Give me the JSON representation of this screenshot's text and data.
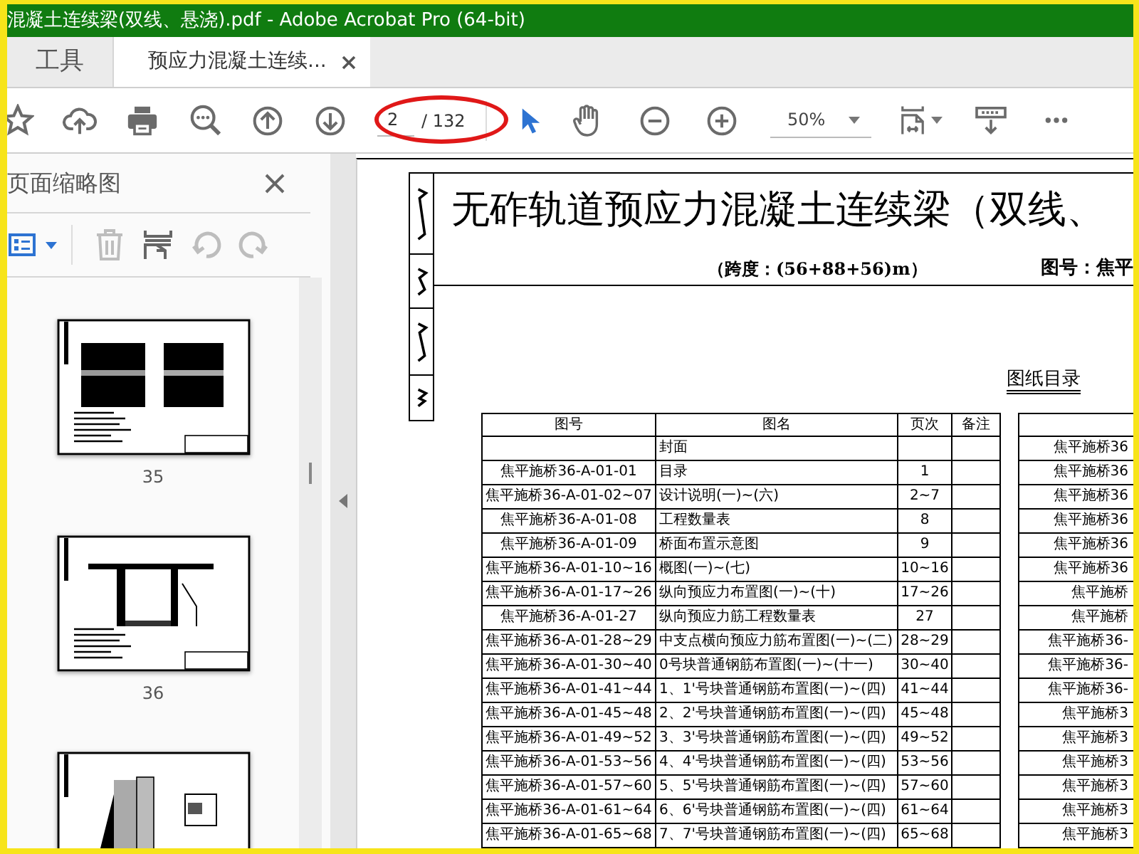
{
  "window": {
    "title": "混凝土连续梁(双线、悬浇).pdf - Adobe Acrobat Pro (64-bit)"
  },
  "tabs": [
    {
      "label": "工具",
      "selected": false,
      "closable": false
    },
    {
      "label": "预应力混凝土连续...",
      "selected": true,
      "closable": true
    }
  ],
  "toolbar": {
    "page_number": "2",
    "page_count": "/ 132",
    "zoom": "50%",
    "tools": [
      {
        "kind": "select",
        "selected": true
      },
      {
        "kind": "hand",
        "selected": false
      }
    ]
  },
  "thumbnails_panel": {
    "title": "页面缩略图",
    "pages": [
      {
        "kind": "plan",
        "label": "35"
      },
      {
        "kind": "section",
        "label": "36"
      },
      {
        "kind": "detail"
      }
    ]
  },
  "document": {
    "title": "无砟轨道预应力混凝土连续梁（双线、",
    "subtitle": "（跨度：(56+88+56)m）",
    "drawing_number": "图号：焦平",
    "list_title": "图纸目录",
    "table": {
      "columns": [
        "图号",
        "图名",
        "页次",
        "备注"
      ],
      "rows": [
        {
          "name": "封面"
        },
        {
          "number": "焦平施桥36-A-01-01",
          "name": "目录",
          "pages": "1"
        },
        {
          "number": "焦平施桥36-A-01-02~07",
          "name": "设计说明(一)~(六)",
          "pages": "2~7"
        },
        {
          "number": "焦平施桥36-A-01-08",
          "name": "工程数量表",
          "pages": "8"
        },
        {
          "number": "焦平施桥36-A-01-09",
          "name": "桥面布置示意图",
          "pages": "9"
        },
        {
          "number": "焦平施桥36-A-01-10~16",
          "name": "概图(一)~(七)",
          "pages": "10~16"
        },
        {
          "number": "焦平施桥36-A-01-17~26",
          "name": "纵向预应力布置图(一)~(十)",
          "pages": "17~26"
        },
        {
          "number": "焦平施桥36-A-01-27",
          "name": "纵向预应力筋工程数量表",
          "pages": "27"
        },
        {
          "number": "焦平施桥36-A-01-28~29",
          "name": "中支点横向预应力筋布置图(一)~(二)",
          "pages": "28~29"
        },
        {
          "number": "焦平施桥36-A-01-30~40",
          "name": "0号块普通钢筋布置图(一)~(十一)",
          "pages": "30~40"
        },
        {
          "number": "焦平施桥36-A-01-41~44",
          "name": "1、1'号块普通钢筋布置图(一)~(四)",
          "pages": "41~44"
        },
        {
          "number": "焦平施桥36-A-01-45~48",
          "name": "2、2'号块普通钢筋布置图(一)~(四)",
          "pages": "45~48"
        },
        {
          "number": "焦平施桥36-A-01-49~52",
          "name": "3、3'号块普通钢筋布置图(一)~(四)",
          "pages": "49~52"
        },
        {
          "number": "焦平施桥36-A-01-53~56",
          "name": "4、4'号块普通钢筋布置图(一)~(四)",
          "pages": "53~56"
        },
        {
          "number": "焦平施桥36-A-01-57~60",
          "name": "5、5'号块普通钢筋布置图(一)~(四)",
          "pages": "57~60"
        },
        {
          "number": "焦平施桥36-A-01-61~64",
          "name": "6、6'号块普通钢筋布置图(一)~(四)",
          "pages": "61~64"
        },
        {
          "number": "焦平施桥36-A-01-65~68",
          "name": "7、7'号块普通钢筋布置图(一)~(四)",
          "pages": "65~68"
        }
      ]
    },
    "table_2": {
      "rows": [
        "焦平施桥36",
        "焦平施桥36",
        "焦平施桥36",
        "焦平施桥36",
        "焦平施桥36",
        "焦平施桥36",
        "焦平施桥",
        "焦平施桥",
        "焦平施桥36-",
        "焦平施桥36-",
        "焦平施桥36-",
        "焦平施桥3",
        "焦平施桥3",
        "焦平施桥3",
        "焦平施桥3",
        "焦平施桥3",
        "焦平施桥3"
      ]
    }
  }
}
